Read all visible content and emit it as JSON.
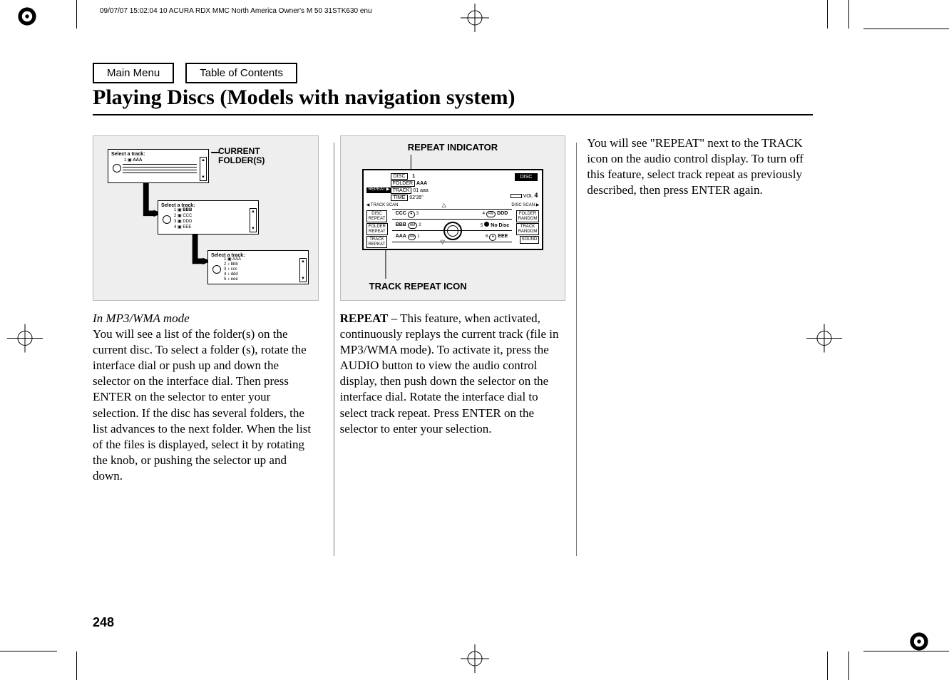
{
  "header": {
    "timestamp_line": "09/07/07 15:02:04    10 ACURA RDX MMC North America Owner's M 50 31STK630 enu"
  },
  "nav": {
    "main_menu": "Main Menu",
    "toc": "Table of Contents"
  },
  "title": "Playing Discs (Models with navigation system)",
  "figure1": {
    "caption": "CURRENT\nFOLDER(S)",
    "select_label": "Select a track:"
  },
  "figure2": {
    "top_label": "REPEAT INDICATOR",
    "bottom_label": "TRACK REPEAT ICON",
    "screen": {
      "disc_label": "DISC",
      "disc_num": "1",
      "folder_label": "FOLDER",
      "folder_val": "AAA",
      "repeat_tag": "REPEAT ▶",
      "track_label": "TRACK",
      "track_val": "01 aaa",
      "time_label": "TIME",
      "time_val": "02'35\"",
      "disc_badge": "DISC",
      "vol_label": "VOL",
      "vol_num": "4",
      "track_scan_l": "◀ TRACK SCAN",
      "track_scan_r": "DISC SCAN ▶",
      "btn_disc_repeat": "DISC\nREPEAT",
      "btn_folder_repeat": "FOLDER\nREPEAT",
      "btn_track_repeat": "TRACK\nREPEAT",
      "btn_folder_random": "FOLDER\nRANDOM",
      "btn_track_random": "TRACK\nRANDOM",
      "btn_sound": "SOUND",
      "row1_l": "CCC",
      "row1_r": "DDD",
      "row2_l": "BBB",
      "row2_r": "No Disc",
      "row3_l": "AAA",
      "row3_r": "EEE",
      "n1": "1",
      "n2": "2",
      "n3": "3",
      "n4": "4",
      "n5": "5",
      "n6": "6"
    }
  },
  "col1": {
    "subhead": "In MP3/WMA mode",
    "body": "You will see a list of the folder(s) on the current disc. To select a folder (s), rotate the interface dial or push up and down the selector on the interface dial. Then press ENTER on the selector to enter your selection. If the disc has several folders, the list advances to the next folder. When the list of the files is displayed, select it by rotating the knob, or pushing the selector up and down."
  },
  "col2": {
    "lead": "REPEAT",
    "dash": " – ",
    "body": "This feature, when activated, continuously replays the current track (file in MP3/WMA mode). To activate it, press the AUDIO button to view the audio control display, then push down the selector on the interface dial. Rotate the interface dial to select track repeat. Press ENTER on the selector to enter your selection."
  },
  "col3": {
    "body": "You will see \"REPEAT\" next to the TRACK icon on the audio control display. To turn off this feature, select track repeat as previously described, then press ENTER again."
  },
  "page_number": "248"
}
